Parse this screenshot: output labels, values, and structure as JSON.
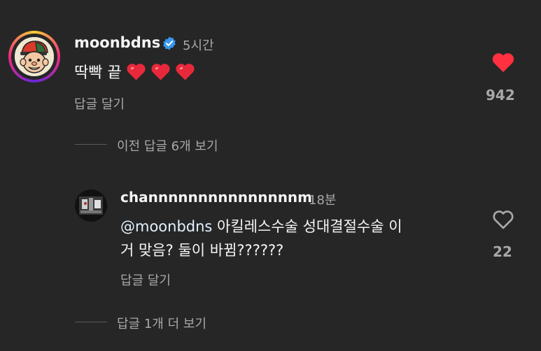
{
  "comment": {
    "username": "moonbdns",
    "time": "5시간",
    "text": "딱빡 끝",
    "reply_label": "답글 달기",
    "like_count": "942",
    "liked": true,
    "like_color": "#ff3040"
  },
  "view_previous": "이전 답글 6개 보기",
  "reply": {
    "username": "channnnnnnnnnnnnnnm",
    "time": "18분",
    "mention": "@moonbdns",
    "text_line1": " 아킬레스수술 성대결절수술 이",
    "text_line2": "거 맞음? 둘이 바뀜??????",
    "reply_label": "답글 달기",
    "like_count": "22"
  },
  "view_more": "답글 1개 더 보기"
}
